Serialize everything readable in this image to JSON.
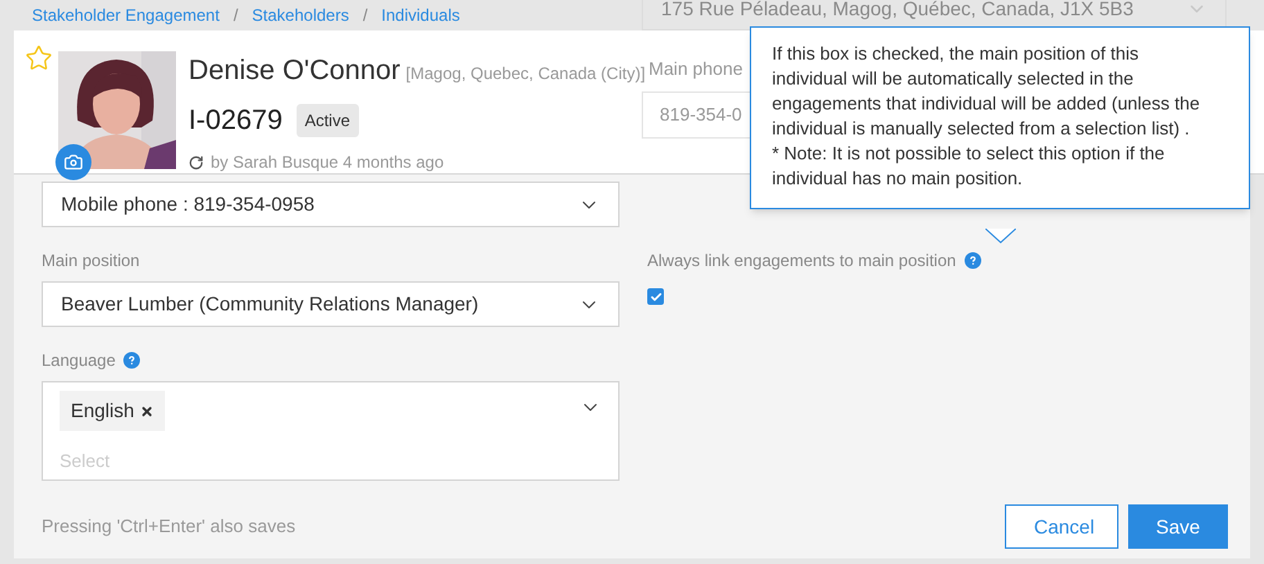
{
  "breadcrumb_separator": "/",
  "breadcrumb": [
    {
      "label": "Stakeholder Engagement"
    },
    {
      "label": "Stakeholders"
    },
    {
      "label": "Individuals"
    }
  ],
  "background": {
    "address": "175 Rue Péladeau, Magog, Québec, Canada, J1X 5B3",
    "phone_label": "Main phone",
    "phone_value": "819-354-0"
  },
  "header": {
    "favorite": false,
    "name": "Denise O'Connor",
    "location": "[Magog, Quebec, Canada (City)]",
    "id": "I-02679",
    "status": "Active",
    "updated": "by Sarah Busque 4 months ago"
  },
  "form": {
    "communication": {
      "value": "Mobile phone : 819-354-0958"
    },
    "main_position": {
      "label": "Main position",
      "value": "Beaver Lumber (Community Relations Manager)"
    },
    "language": {
      "label": "Language",
      "tags": [
        "English"
      ],
      "placeholder": "Select"
    },
    "link": {
      "label": "Always link engagements to main position",
      "checked": true
    },
    "tooltip": "If this box is checked, the main position of this individual will be automatically selected in the engagements that individual will be added (unless the individual is manually selected from a selection list) .\n* Note: It is not possible to select this option if the individual has no main position."
  },
  "footer": {
    "hint": "Pressing 'Ctrl+Enter' also saves",
    "buttons": [
      {
        "label": "Cancel",
        "kind": "secondary"
      },
      {
        "label": "Save",
        "kind": "primary"
      }
    ]
  }
}
